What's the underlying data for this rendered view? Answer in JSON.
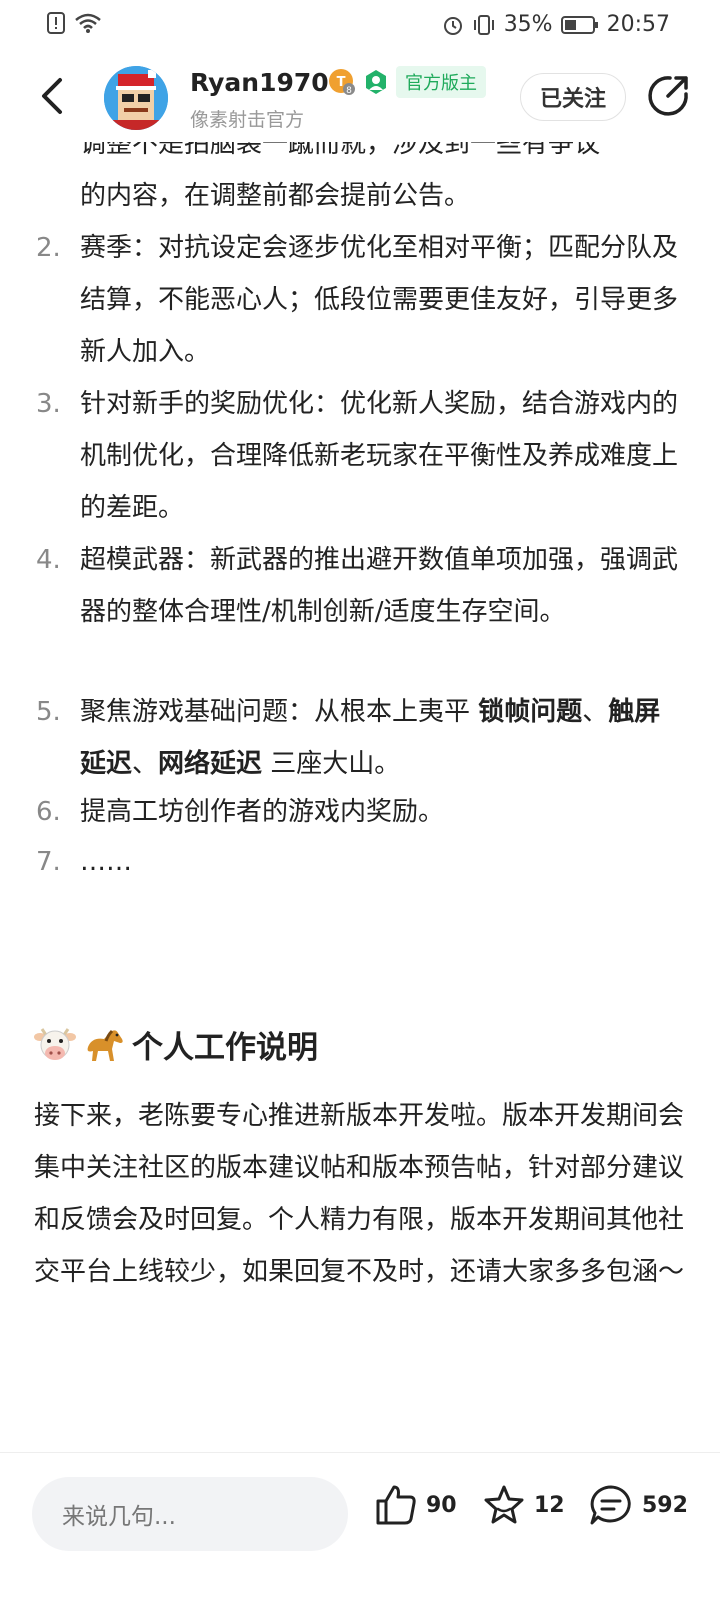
{
  "status_bar": {
    "battery": "35%",
    "time": "20:57"
  },
  "header": {
    "username": "Ryan1970",
    "level_badge": "8",
    "role_tag": "官方版主",
    "subtitle": "像素射击官方",
    "follow_label": "已关注"
  },
  "post": {
    "cut_line": "调整不是拍脑袋一蹴而就，涉及到一些有争议",
    "item1_tail": "的内容，在调整前都会提前公告。",
    "items": [
      {
        "num": "2.",
        "text": "赛季：对抗设定会逐步优化至相对平衡；匹配分队及结算，不能恶心人；低段位需要更佳友好，引导更多新人加入。"
      },
      {
        "num": "3.",
        "text": "针对新手的奖励优化：优化新人奖励，结合游戏内的机制优化，合理降低新老玩家在平衡性及养成难度上的差距。"
      },
      {
        "num": "4.",
        "text": "超模武器：新武器的推出避开数值单项加强，强调武器的整体合理性/机制创新/适度生存空间。"
      },
      {
        "num": "5.",
        "text_a": "聚焦游戏基础问题：从根本上夷平 ",
        "bold_1": "锁帧问题",
        "sep_1": "、",
        "bold_2": "触屏延迟",
        "sep_2": "、",
        "bold_3": "网络延迟",
        "text_b": " 三座大山。"
      },
      {
        "num": "6.",
        "text": "提高工坊创作者的游戏内奖励。"
      },
      {
        "num": "7.",
        "text": "……"
      }
    ],
    "section_title": "个人工作说明",
    "section_icons": [
      "cow-icon",
      "horse-icon"
    ],
    "paragraph": "接下来，老陈要专心推进新版本开发啦。版本开发期间会集中关注社区的版本建议帖和版本预告帖，针对部分建议和反馈会及时回复。个人精力有限，版本开发期间其他社交平台上线较少，如果回复不及时，还请大家多多包涵～"
  },
  "bottom_bar": {
    "comment_placeholder": "来说几句...",
    "likes": "90",
    "favorites": "12",
    "comments": "592"
  },
  "colors": {
    "admin_tag_bg": "#e6f8ee",
    "admin_tag_text": "#1faa5b",
    "level_badge": "#f0a030"
  }
}
